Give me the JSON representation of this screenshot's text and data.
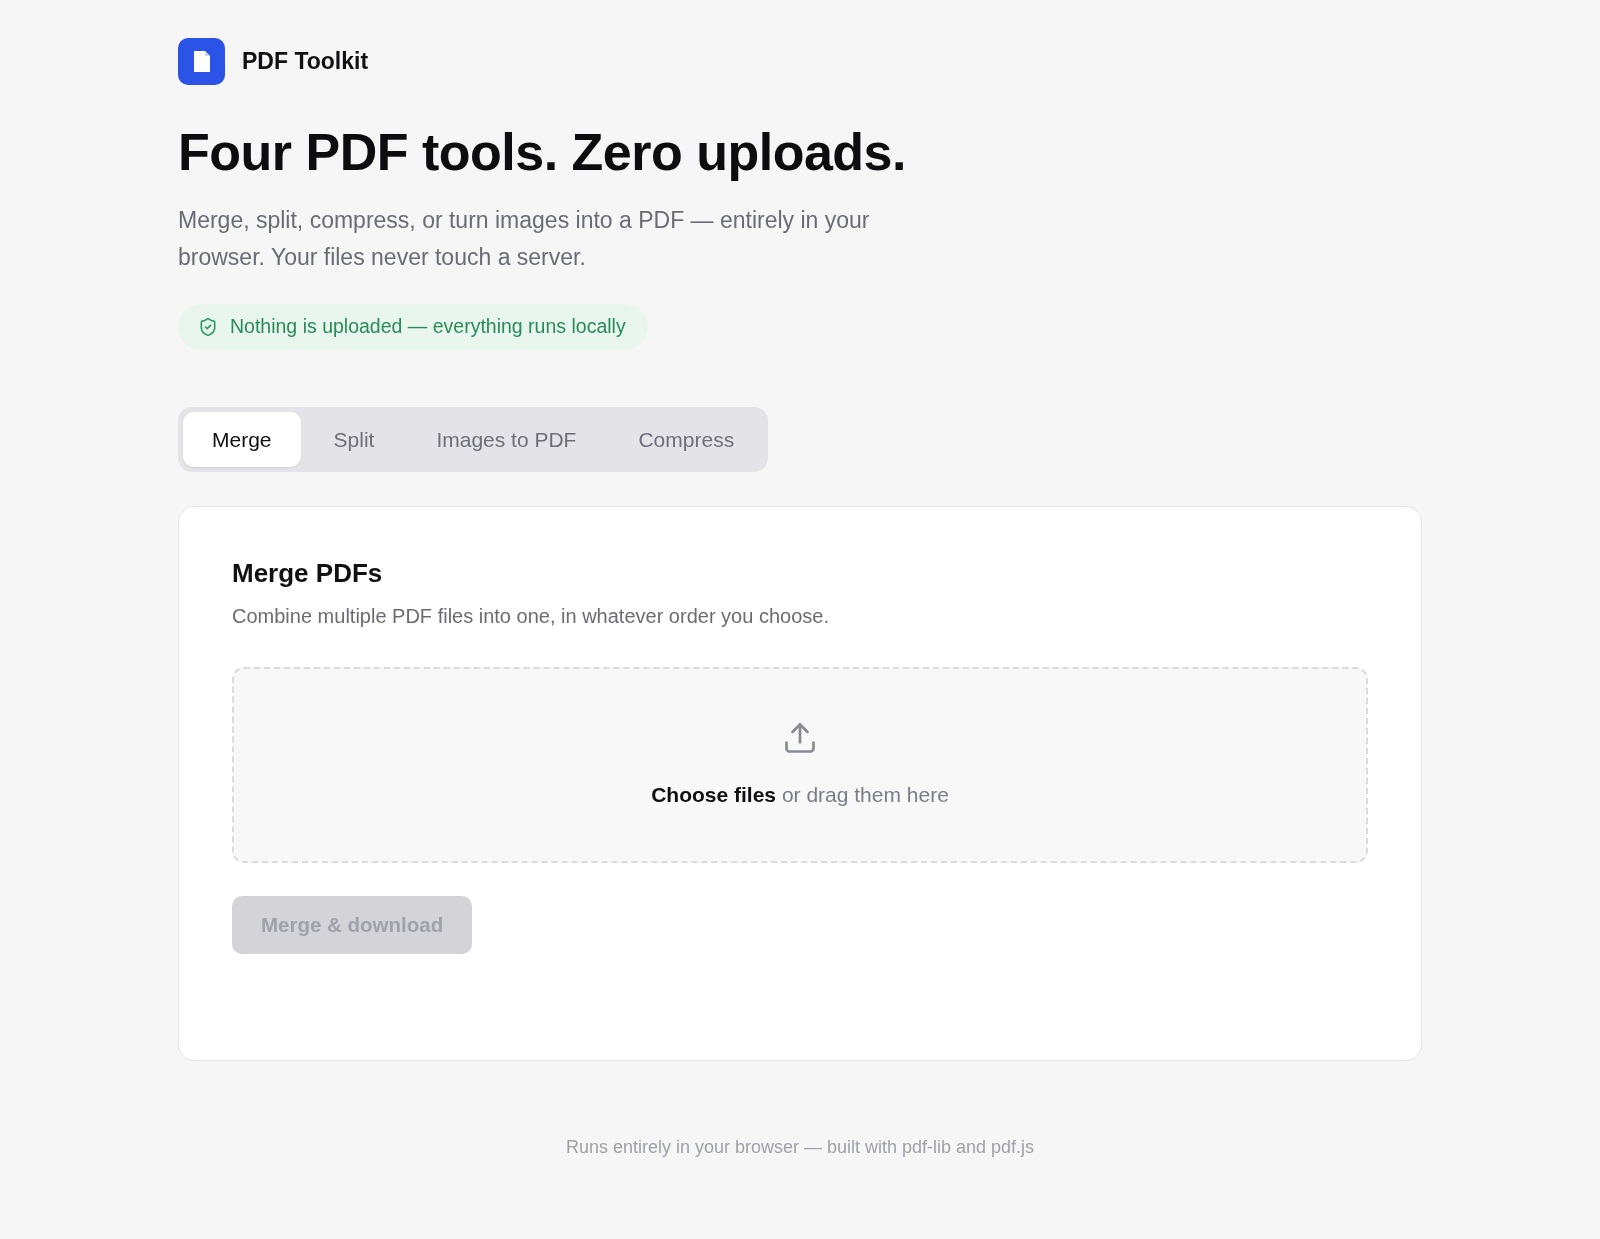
{
  "brand": {
    "name": "PDF Toolkit"
  },
  "hero": {
    "title": "Four PDF tools. Zero uploads.",
    "subtitle": "Merge, split, compress, or turn images into a PDF — entirely in your browser. Your files never touch a server.",
    "badge": "Nothing is uploaded — everything runs locally"
  },
  "tabs": [
    {
      "label": "Merge",
      "selected": true
    },
    {
      "label": "Split",
      "selected": false
    },
    {
      "label": "Images to PDF",
      "selected": false
    },
    {
      "label": "Compress",
      "selected": false
    }
  ],
  "panel": {
    "title": "Merge PDFs",
    "description": "Combine multiple PDF files into one, in whatever order you choose.",
    "dropzone": {
      "text": "**Choose files** or drag them here"
    },
    "button": {
      "label": "Merge & download",
      "disabled": true
    }
  },
  "footer": {
    "text": "Runs entirely in your browser — built with pdf-lib and pdf.js"
  }
}
